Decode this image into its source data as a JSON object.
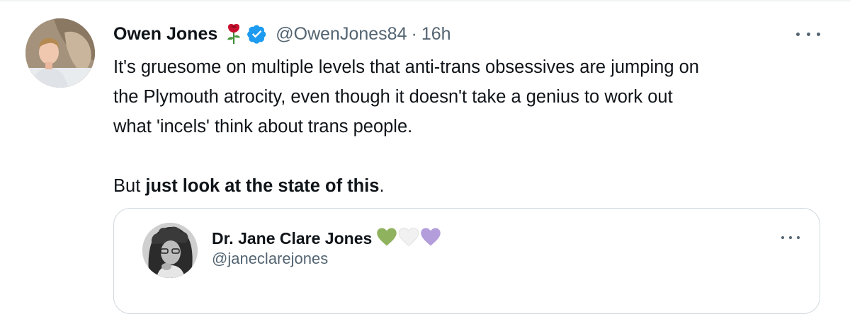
{
  "tweet": {
    "author_name": "Owen Jones",
    "author_emoji_icon": "rose-icon",
    "verified_icon": "verified-badge-icon",
    "handle": "@OwenJones84",
    "separator": "·",
    "timestamp": "16h",
    "more_icon": "more-options-icon",
    "body": {
      "line1": "It's gruesome on multiple levels that anti-trans obsessives are jumping on",
      "line2": "the Plymouth atrocity, even though it doesn't take a genius to work out",
      "line3": "what 'incels' think about trans people.",
      "line4_prefix": "But ",
      "line4_bold": "just look at the state of this",
      "line4_suffix": "."
    }
  },
  "quoted_tweet": {
    "author_name": "Dr. Jane Clare Jones",
    "hearts": [
      "green-heart-icon",
      "white-heart-icon",
      "purple-heart-icon"
    ],
    "handle": "@janeclarejones",
    "more_icon": "more-options-icon"
  },
  "colors": {
    "text_primary": "#0f1419",
    "text_secondary": "#536471",
    "verified_blue": "#1d9bf0",
    "card_border": "#cfd9de",
    "heart_green": "#8fb25e",
    "heart_white": "#f1f1f1",
    "heart_purple": "#b39ddb"
  }
}
